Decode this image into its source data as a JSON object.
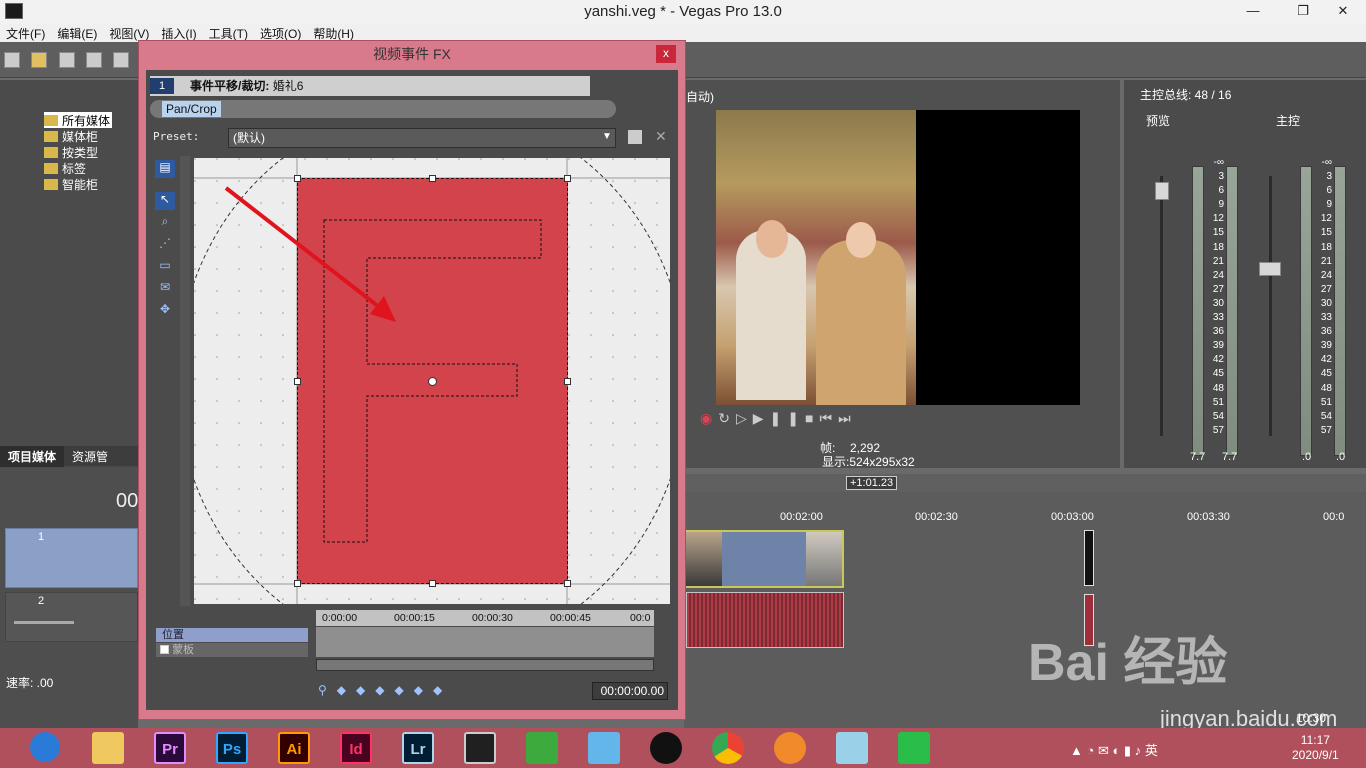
{
  "window": {
    "title": "yanshi.veg * - Vegas Pro 13.0",
    "minimize": "—",
    "maximize": "❐",
    "close": "✕"
  },
  "menu": [
    "文件(F)",
    "编辑(E)",
    "视图(V)",
    "插入(I)",
    "工具(T)",
    "选项(O)",
    "帮助(H)"
  ],
  "explorer": {
    "items": [
      "所有媒体",
      "媒体柜",
      "按类型",
      "标签",
      "智能柜"
    ],
    "tabs": [
      "项目媒体",
      "资源管"
    ]
  },
  "tracks": {
    "timecode": "00",
    "track1_num": "1",
    "track2_num": "2",
    "rate_label": "速率: .00"
  },
  "preview": {
    "quality_label": "自动)",
    "frame_label": "帧:",
    "frame_value": "2,292",
    "display_label": "显示:",
    "display_value": "524x295x32"
  },
  "mixer": {
    "title": "主控总线: 48 / 16",
    "preview_label": "预览",
    "master_label": "主控",
    "scale": [
      "-∞",
      "3",
      "6",
      "9",
      "12",
      "15",
      "18",
      "21",
      "24",
      "27",
      "30",
      "33",
      "36",
      "39",
      "42",
      "45",
      "48",
      "51",
      "54",
      "57"
    ],
    "left_vals": [
      "7.7",
      "7.7"
    ],
    "right_vals": [
      ".0",
      ".0"
    ]
  },
  "timeline": {
    "cursor_label": "+1:01.23",
    "ruler": [
      "00:02:00",
      "00:02:30",
      "00:03:00",
      "00:03:30",
      "00:0"
    ],
    "end_time": "10:30"
  },
  "dialog": {
    "title": "视频事件 FX",
    "close": "x",
    "chain_num": "1",
    "chain_label": "事件平移/裁切:",
    "chain_clip": "婚礼6",
    "fx_tab": "Pan/Crop",
    "preset_label": "Preset:",
    "preset_value": "(默认)",
    "kf_position": "位置",
    "kf_mask": "蒙板",
    "kf_ruler": [
      "0:00:00",
      "00:00:15",
      "00:00:30",
      "00:00:45",
      "00:0"
    ],
    "kf_time": "00:00:00.00"
  },
  "watermark": {
    "brand": "Bai 经验",
    "url": "jingyan.baidu.com"
  },
  "taskbar": {
    "apps": [
      "Pr",
      "Ps",
      "Ai",
      "Id",
      "Lr"
    ],
    "tray_lang": "英",
    "time": "11:17",
    "date": "2020/9/1"
  }
}
